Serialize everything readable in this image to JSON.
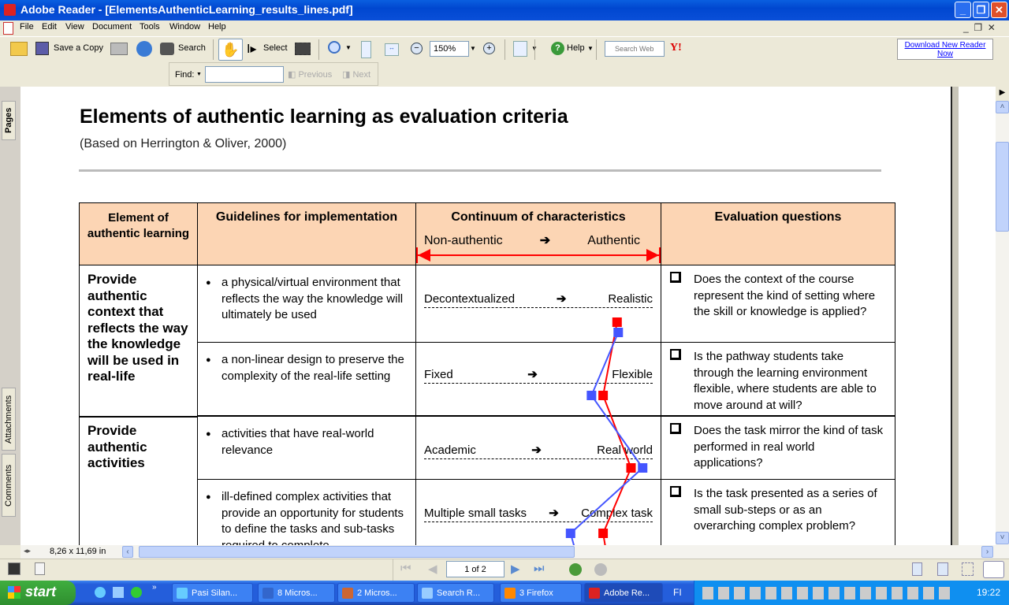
{
  "window": {
    "title": "Adobe Reader - [ElementsAuthenticLearning_results_lines.pdf]"
  },
  "menu": [
    "File",
    "Edit",
    "View",
    "Document",
    "Tools",
    "Window",
    "Help"
  ],
  "toolbar": {
    "save_copy": "Save a Copy",
    "search": "Search",
    "select": "Select",
    "zoom_value": "150%",
    "help": "Help",
    "search_web_placeholder": "Search Web",
    "download_line1": "Download New Reader",
    "download_line2": "Now"
  },
  "find": {
    "label": "Find:",
    "value": "",
    "previous": "Previous",
    "next": "Next"
  },
  "side_tabs": [
    "Pages",
    "Attachments",
    "Comments"
  ],
  "status": {
    "page_size": "8,26 x 11,69 in",
    "page_indicator": "1 of 2"
  },
  "document": {
    "title": "Elements of authentic learning as evaluation criteria",
    "subtitle": "(Based on Herrington & Oliver, 2000)",
    "headers": {
      "element": "Element of authentic learning",
      "guidelines": "Guidelines for implementation",
      "continuum": "Continuum of characteristics",
      "non_authentic": "Non-authentic",
      "arrow": "➔",
      "authentic": "Authentic",
      "questions": "Evaluation questions"
    },
    "elements": [
      {
        "name": "Provide authentic context that reflects the way the knowledge will be used in real-life"
      },
      {
        "name": "Provide authentic activities"
      }
    ],
    "rows": [
      {
        "guideline": "a physical/virtual environment that reflects the way the knowledge will ultimately be used",
        "left": "Decontextualized",
        "right": "Realistic",
        "question": "Does the context of the course represent the kind of setting where the skill or knowledge is applied?"
      },
      {
        "guideline": "a non-linear design to preserve the complexity of the real-life setting",
        "left": "Fixed",
        "right": "Flexible",
        "question": "Is the pathway students take through the learning environment flexible, where students are able to move around at will?"
      },
      {
        "guideline": "activities that have real-world relevance",
        "left": "Academic",
        "right": "Real world",
        "question": "Does the task mirror the kind of task performed in real world applications?"
      },
      {
        "guideline": "ill-defined complex activities that provide an opportunity for students to define the tasks and sub-tasks required to complete",
        "left": "Multiple small tasks",
        "right": "Complex task",
        "question": "Is the task presented as a series of small sub-steps or as an overarching complex problem?"
      }
    ]
  },
  "chart_data": {
    "type": "line",
    "scale": [
      0,
      1
    ],
    "categories": [
      "Decontextualized-Realistic",
      "Fixed-Flexible",
      "Academic-Real world",
      "Multiple small tasks-Complex task"
    ],
    "series": [
      {
        "color": "#ff0000",
        "values": [
          0.84,
          0.78,
          0.9,
          0.78
        ]
      },
      {
        "color": "#4455ff",
        "values": [
          0.845,
          0.73,
          0.95,
          0.64
        ]
      }
    ]
  },
  "taskbar": {
    "start": "start",
    "tasks": [
      "Pasi Silan...",
      "8 Micros...",
      "2 Micros...",
      "Search R...",
      "3 Firefox",
      "Adobe Re..."
    ],
    "lang": "FI",
    "clock": "19:22"
  }
}
